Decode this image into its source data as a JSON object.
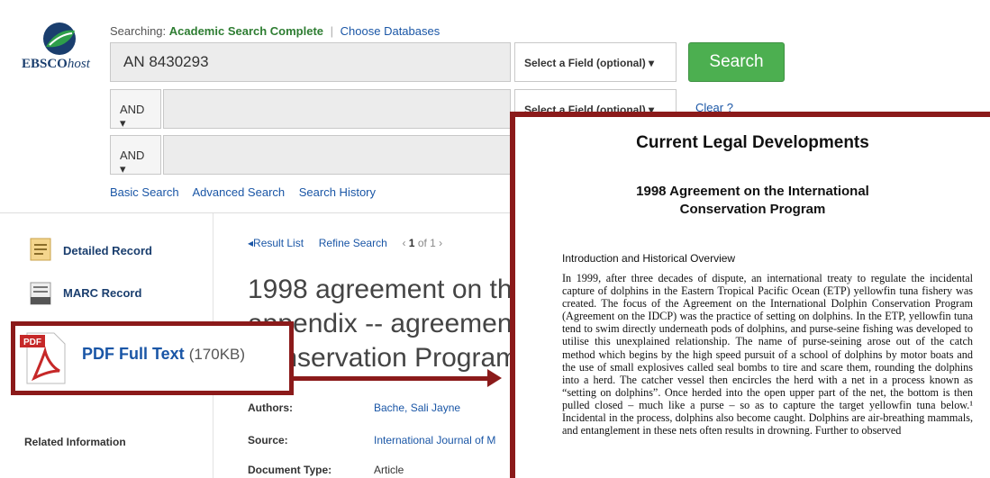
{
  "header": {
    "logo_text": "EBSCO",
    "logo_host": "host",
    "searching_label": "Searching:",
    "database": "Academic Search Complete",
    "choose_databases": "Choose Databases",
    "search_value": "AN 8430293",
    "operator_2": "AND",
    "operator_3": "AND",
    "field_1": "Select a Field (optional)",
    "field_2": "Select a Field (optional)",
    "search_button": "Search",
    "clear": "Clear",
    "help": "?",
    "links": [
      "Basic Search",
      "Advanced Search",
      "Search History"
    ]
  },
  "sidebar": {
    "items": [
      {
        "label": "Detailed Record",
        "icon": "document-icon"
      },
      {
        "label": "MARC Record",
        "icon": "marc-icon"
      }
    ],
    "pdf_label": "PDF Full Text",
    "pdf_size": "(170KB)",
    "related": "Related Information"
  },
  "result": {
    "nav_result_list": "Result List",
    "nav_refine": "Refine Search",
    "nav_count_bold": "1",
    "nav_count_rest": "of 1",
    "title_lines": [
      "1998 agreement on th",
      "appendix -- agreemen",
      "Conservation Program"
    ],
    "meta": [
      {
        "label": "Authors:",
        "value": "Bache, Sali Jayne",
        "link": true
      },
      {
        "label": "Source:",
        "value": "International Journal of M",
        "link": true
      },
      {
        "label": "Document Type:",
        "value": "Article",
        "link": false
      }
    ]
  },
  "document": {
    "heading": "Current Legal Developments",
    "subheading_1": "1998 Agreement on the International",
    "subheading_2": "Conservation Program",
    "section": "Introduction and Historical Overview",
    "body": "In 1999, after three decades of dispute, an international treaty to regulate the incidental capture of dolphins in the Eastern Tropical Pacific Ocean (ETP) yellowfin tuna fishery was created. The focus of the Agreement on the International Dolphin Conservation Program (Agreement on the IDCP) was the practice of setting on dolphins. In the ETP, yellowfin tuna tend to swim directly underneath pods of dolphins, and purse-seine fishing was developed to utilise this unexplained relationship. The name of purse-seining arose out of the catch method which begins by the high speed pursuit of a school of dolphins by motor boats and the use of small explosives called seal bombs to tire and scare them, rounding the dolphins into a herd. The catcher vessel then encircles the herd with a net in a process known as “setting on dolphins”. Once herded into the open upper part of the net, the bottom is then pulled closed – much like a purse – so as to capture the target yellowfin tuna below.¹ Incidental in the process, dolphins also become caught. Dolphins are air-breathing mammals, and entanglement in these nets often results in drowning. Further to observed"
  },
  "colors": {
    "accent_green": "#4caf50",
    "link_blue": "#1a56a6",
    "highlight_red": "#8b1a1a"
  }
}
